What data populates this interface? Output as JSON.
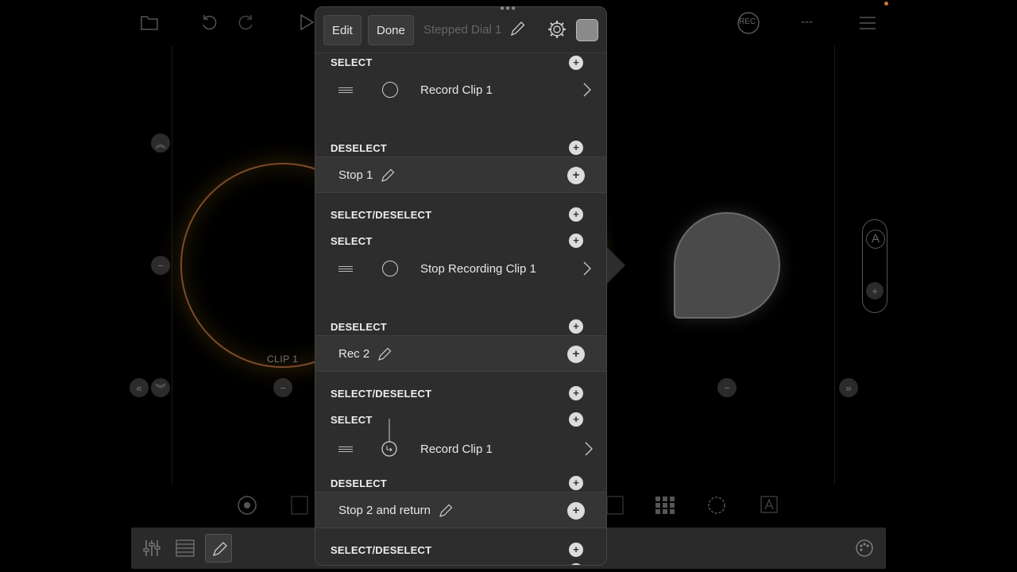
{
  "background": {
    "rec_label": "REC",
    "dash_label": "---",
    "dial_label": "CLIP 1",
    "side_pill_letter": "A"
  },
  "panel": {
    "toolbar": {
      "edit_label": "Edit",
      "done_label": "Done",
      "title": "Stepped Dial 1"
    },
    "sections": [
      {
        "type": "section",
        "label": "SELECT"
      },
      {
        "type": "action",
        "label": "Record Clip 1"
      },
      {
        "type": "section",
        "label": "DESELECT"
      },
      {
        "type": "message",
        "label": "Stop 1"
      },
      {
        "type": "section",
        "label": "SELECT/DESELECT"
      },
      {
        "type": "section",
        "label": "SELECT"
      },
      {
        "type": "action",
        "label": "Stop Recording Clip 1"
      },
      {
        "type": "section",
        "label": "DESELECT"
      },
      {
        "type": "message",
        "label": "Rec 2"
      },
      {
        "type": "section",
        "label": "SELECT/DESELECT"
      },
      {
        "type": "section",
        "label": "SELECT"
      },
      {
        "type": "action",
        "label": "Record Clip 1"
      },
      {
        "type": "section",
        "label": "DESELECT"
      },
      {
        "type": "message",
        "label": "Stop 2 and return"
      },
      {
        "type": "section",
        "label": "SELECT/DESELECT"
      }
    ]
  },
  "colors": {
    "accent_orange": "#c77b2a",
    "panel_bg": "#2d2d2d"
  }
}
